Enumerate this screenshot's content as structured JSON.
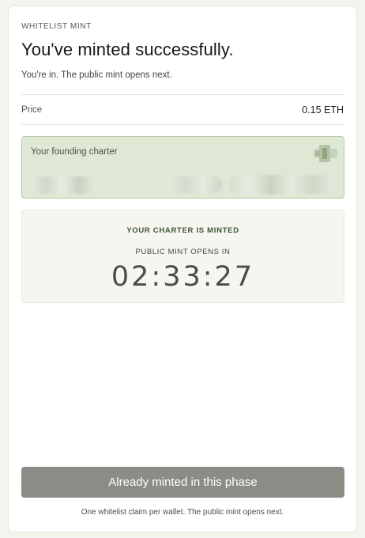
{
  "header": {
    "eyebrow": "WHITELIST MINT",
    "title": "You've minted successfully.",
    "subtitle": "You're in. The public mint opens next."
  },
  "price": {
    "label": "Price",
    "value": "0.15 ETH"
  },
  "charter": {
    "label": "Your founding charter",
    "accent_color": "#b8ccaa",
    "background_color": "#dfe8d5"
  },
  "status": {
    "heading": "YOUR CHARTER IS MINTED",
    "subheading": "PUBLIC MINT OPENS IN",
    "countdown": "02:33:27"
  },
  "action": {
    "button_label": "Already minted in this phase",
    "button_color": "#8c8c87",
    "footnote": "One whitelist claim per wallet. The public mint opens next."
  }
}
